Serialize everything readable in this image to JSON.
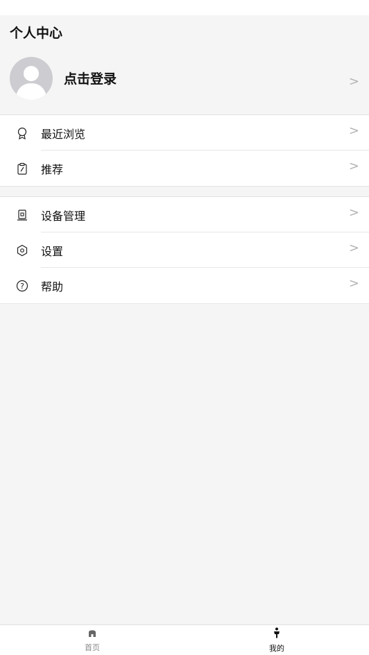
{
  "header": {
    "title": "个人中心"
  },
  "profile": {
    "login_label": "点击登录",
    "chevron": ">"
  },
  "menu_group_1": [
    {
      "label": "最近浏览",
      "icon": "badge-icon",
      "chevron": ">"
    },
    {
      "label": "推荐",
      "icon": "clipboard-icon",
      "chevron": ">"
    }
  ],
  "menu_group_2": [
    {
      "label": "设备管理",
      "icon": "device-icon",
      "chevron": ">"
    },
    {
      "label": "设置",
      "icon": "settings-icon",
      "chevron": ">"
    },
    {
      "label": "帮助",
      "icon": "help-icon",
      "chevron": ">"
    }
  ],
  "tabs": [
    {
      "label": "首页",
      "icon": "home-icon",
      "active": false
    },
    {
      "label": "我的",
      "icon": "person-icon",
      "active": true
    }
  ],
  "colors": {
    "background": "#f5f5f5",
    "card": "#ffffff",
    "avatar_bg": "#cdccd1",
    "chevron": "#b3b3b3",
    "inactive_tab": "#888888",
    "active_tab": "#111111"
  }
}
